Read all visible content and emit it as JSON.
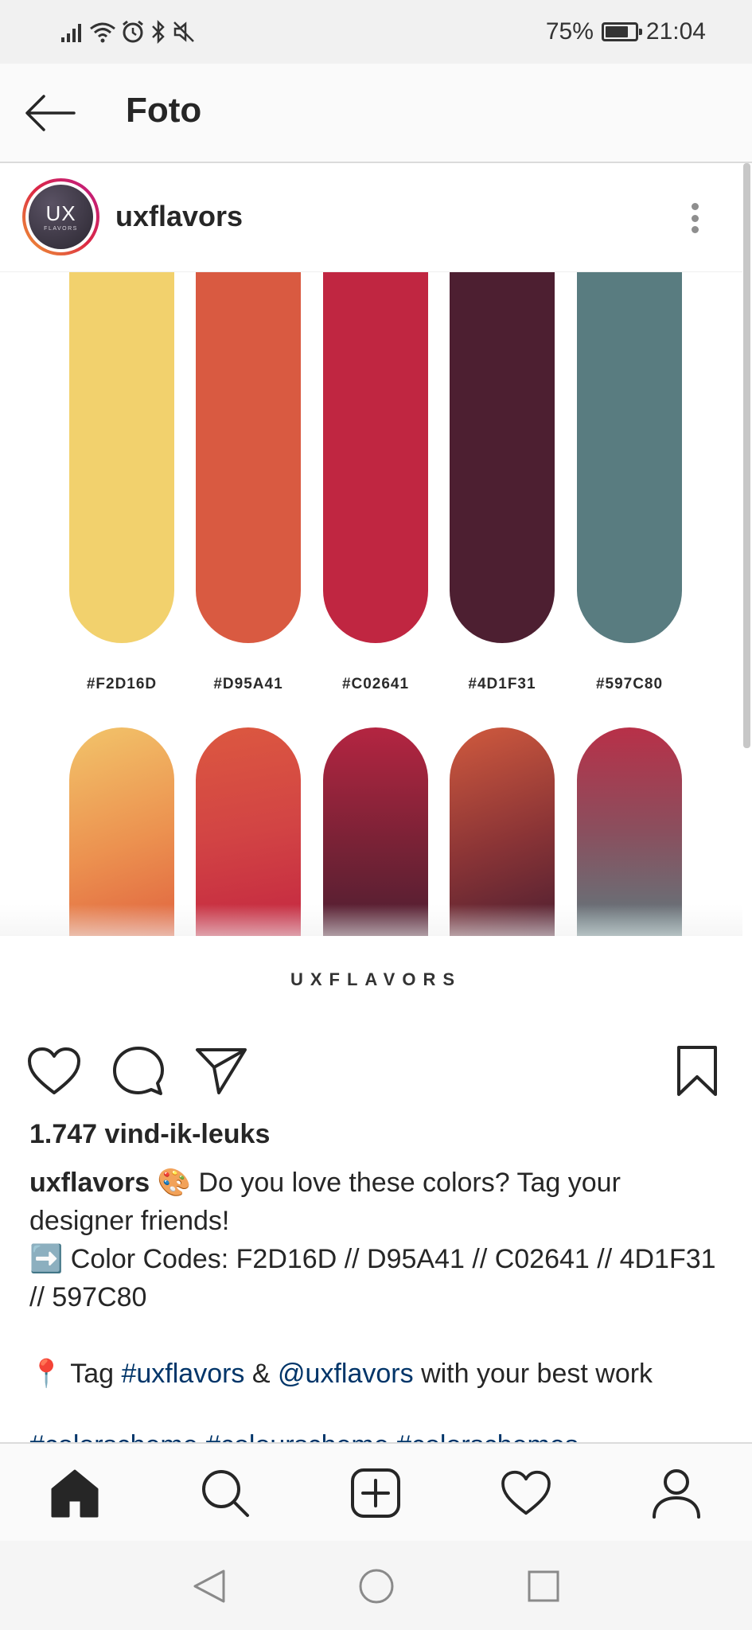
{
  "status_bar": {
    "battery_percent": "75%",
    "time": "21:04"
  },
  "header": {
    "title": "Foto"
  },
  "post": {
    "username": "uxflavors",
    "avatar": {
      "main": "UX",
      "sub": "FLAVORS"
    },
    "palette": [
      {
        "hex": "#F2D16D",
        "label": "#F2D16D"
      },
      {
        "hex": "#D95A41",
        "label": "#D95A41"
      },
      {
        "hex": "#C02641",
        "label": "#C02641"
      },
      {
        "hex": "#4D1F31",
        "label": "#4D1F31"
      },
      {
        "hex": "#597C80",
        "label": "#597C80"
      }
    ],
    "brand": "UXFLAVORS",
    "likes": "1.747 vind-ik-leuks",
    "caption": {
      "username": "uxflavors",
      "emoji": "🎨",
      "line1": "Do you love these colors? Tag your designer friends!",
      "arrow": "➡️",
      "line2": "Color Codes: F2D16D // D95A41 // C02641 // 4D1F31 // 597C80",
      "pin": "📍",
      "tag_prefix": "Tag",
      "hashtag": "#uxflavors",
      "amp": "&",
      "mention": "@uxflavors",
      "tag_suffix": "with your best work"
    },
    "hashtags": "#colorscheme #colourscheme #colorschemes"
  },
  "icons": {
    "back": "arrow-left-icon",
    "more": "more-vertical-icon",
    "like": "heart-icon",
    "comment": "comment-icon",
    "share": "paper-plane-icon",
    "save": "bookmark-icon",
    "home": "home-icon",
    "search": "search-icon",
    "add": "plus-square-icon",
    "activity": "heart-icon",
    "profile": "person-icon"
  }
}
